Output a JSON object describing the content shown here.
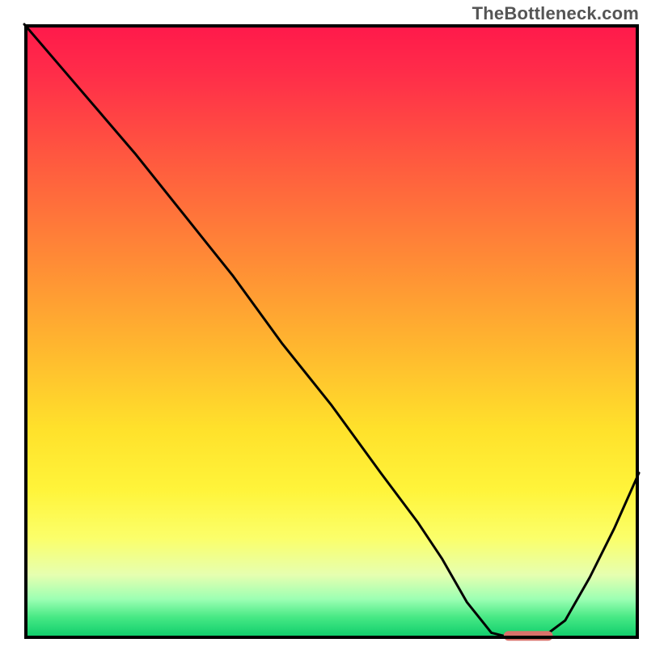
{
  "watermark": "TheBottleneck.com",
  "chart_data": {
    "type": "line",
    "title": "",
    "xlabel": "",
    "ylabel": "",
    "x_range": [
      0,
      100
    ],
    "y_range": [
      0,
      100
    ],
    "grid": false,
    "legend": false,
    "gradient_stops": [
      {
        "pos": 0,
        "color": "#ff1a4b"
      },
      {
        "pos": 8,
        "color": "#ff2e49"
      },
      {
        "pos": 22,
        "color": "#ff5a3f"
      },
      {
        "pos": 38,
        "color": "#ff8a36"
      },
      {
        "pos": 52,
        "color": "#ffb52f"
      },
      {
        "pos": 66,
        "color": "#ffe12b"
      },
      {
        "pos": 76,
        "color": "#fff43a"
      },
      {
        "pos": 84,
        "color": "#fbff6a"
      },
      {
        "pos": 90,
        "color": "#e6ffb0"
      },
      {
        "pos": 94,
        "color": "#9cffb3"
      },
      {
        "pos": 97,
        "color": "#46e884"
      },
      {
        "pos": 100,
        "color": "#12cf6d"
      }
    ],
    "series": [
      {
        "name": "bottleneck-curve",
        "x": [
          0,
          6,
          12,
          18,
          22,
          26,
          34,
          42,
          50,
          58,
          64,
          68,
          72,
          76,
          80,
          84,
          88,
          92,
          96,
          100
        ],
        "values": [
          100,
          93,
          86,
          79,
          74,
          69,
          59,
          48,
          38,
          27,
          19,
          13,
          6,
          1,
          0,
          0,
          3,
          10,
          18,
          27
        ]
      }
    ],
    "marker": {
      "x_start": 78,
      "x_end": 86,
      "y": 0.5,
      "color": "#d9716a"
    }
  }
}
